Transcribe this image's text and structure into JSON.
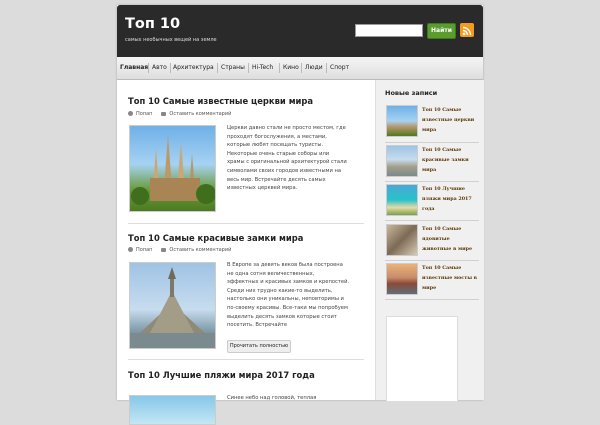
{
  "header": {
    "title": "Топ 10",
    "tagline": "самых необычных вещей на земле",
    "search_placeholder": "",
    "search_button": "Найти"
  },
  "nav": {
    "items": [
      "Главная",
      "Авто",
      "Архитектура",
      "Страны",
      "Hi-Tech",
      "Кино",
      "Люди",
      "Спорт"
    ]
  },
  "posts": [
    {
      "title": "Топ 10 Самые известные церкви мира",
      "author": "Попап",
      "comment": "Оставить комментарий",
      "lines": [
        "Церкви давно стали не просто местом, где",
        "проходят богослужения, а местами,",
        "которые любят посещать туристы.",
        "Некоторые  очень старые соборы или",
        "храмы  с оригинальной архитектурой  стали",
        "символами своих  городов известными на",
        "весь мир. Встречайте десять самых",
        "известных церквей мира."
      ]
    },
    {
      "title": "Топ 10 Самые красивые замки мира",
      "author": "Попап",
      "comment": "Оставить комментарий",
      "lines": [
        "В Европе за девять веков была построена",
        "не одна сотня величественных,",
        "эффектных и красивых замков и крепостей.",
        "Среди них трудно какие-то выделить,",
        "настолько они уникальны, неповторимы и",
        "по-своему красивы. Все-таки мы попробуем",
        "выделить десять замков которые стоит",
        "посетить. Встречайте"
      ],
      "more": "Прочитать полностью"
    },
    {
      "title": "Топ 10 Лучшие пляжи мира 2017 года",
      "lines": [
        "Синее небо над головой, теплая"
      ]
    }
  ],
  "sidebar": {
    "title": "Новые записи",
    "items": [
      {
        "lines": [
          "Топ 10 Самые",
          "известные церкви",
          "мира"
        ]
      },
      {
        "lines": [
          "Топ 10 Самые",
          "красивые замки",
          "мира"
        ]
      },
      {
        "lines": [
          "Топ 10 Лучшие",
          "пляжи мира 2017",
          "года"
        ]
      },
      {
        "lines": [
          "Топ 10 Самые",
          "ядовитые",
          "животные в мире"
        ]
      },
      {
        "lines": [
          "Топ 10 Самые",
          "известные мосты в",
          "мире"
        ]
      }
    ]
  },
  "icons": {
    "rss": "rss-icon",
    "user": "user-icon",
    "comment": "comment-icon"
  }
}
